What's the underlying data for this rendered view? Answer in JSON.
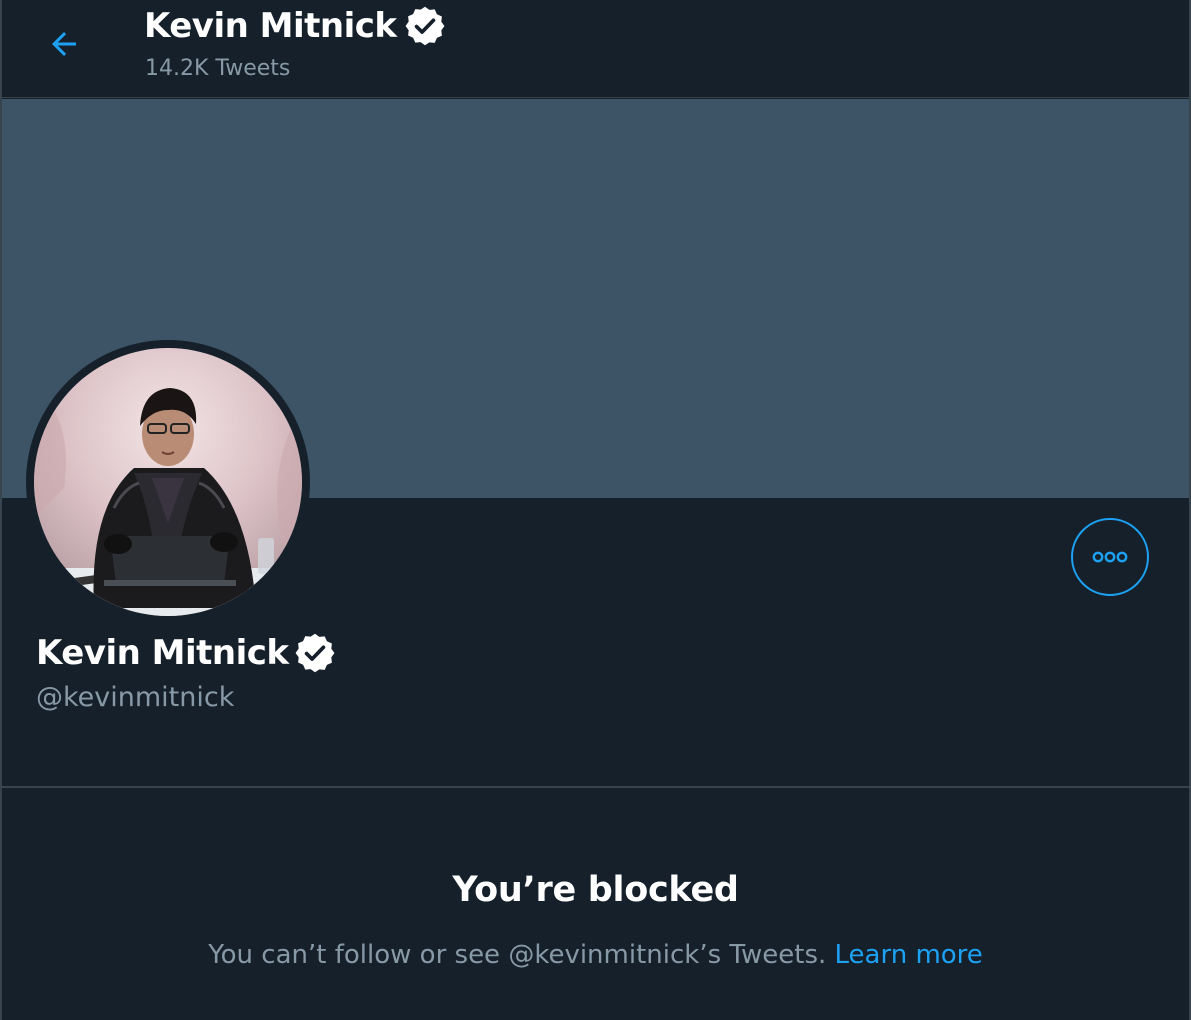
{
  "header": {
    "back_icon": "arrow-left-icon",
    "name": "Kevin Mitnick",
    "verified_icon": "verified-badge-icon",
    "tweet_count": "14.2K Tweets"
  },
  "profile": {
    "name": "Kevin Mitnick",
    "handle": "@kevinmitnick",
    "verified_icon": "verified-badge-icon",
    "more_icon": "more-horizontal-icon"
  },
  "blocked": {
    "title": "You’re blocked",
    "message": "You can’t follow or see @kevinmitnick’s Tweets.",
    "learn_more": "Learn more"
  },
  "colors": {
    "background": "#15202b",
    "banner": "#3d5466",
    "accent": "#1da1f2",
    "secondary_text": "#8899a6",
    "border": "#38444d"
  }
}
